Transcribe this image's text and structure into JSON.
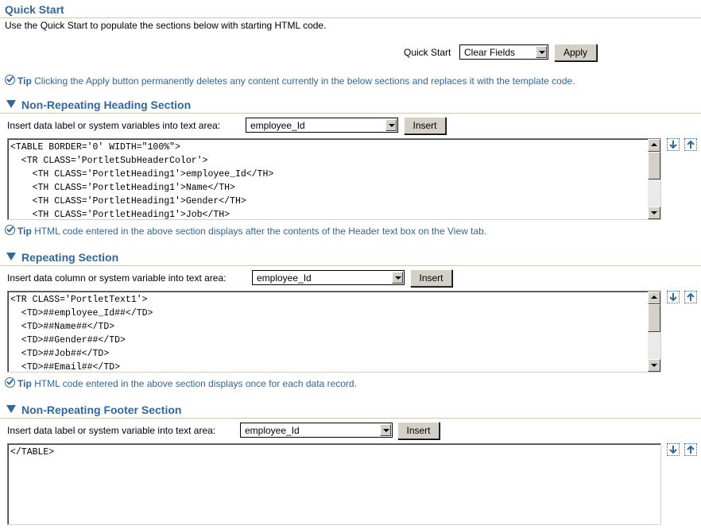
{
  "quick_start": {
    "title": "Quick Start",
    "description": "Use the Quick Start to populate the sections below with starting HTML code.",
    "label": "Quick Start",
    "selected": "Clear Fields",
    "apply_label": "Apply",
    "tip_label": "Tip",
    "tip_text": "Clicking the Apply button permanently deletes any content currently in the below sections and replaces it with the template code."
  },
  "heading_section": {
    "title": "Non-Repeating Heading Section",
    "insert_label": "Insert data label or system variables into text area:",
    "selected": "employee_Id",
    "insert_button": "Insert",
    "code": "<TABLE BORDER='0' WIDTH=\"100%\">\n  <TR CLASS='PortletSubHeaderColor'>\n    <TH CLASS='PortletHeading1'>employee_Id</TH>\n    <TH CLASS='PortletHeading1'>Name</TH>\n    <TH CLASS='PortletHeading1'>Gender</TH>\n    <TH CLASS='PortletHeading1'>Job</TH>",
    "tip_label": "Tip",
    "tip_text": "HTML code entered in the above section displays after the contents of the Header text box on the View tab."
  },
  "repeating_section": {
    "title": "Repeating Section",
    "insert_label": "Insert data column or system variable into text area:",
    "selected": "employee_Id",
    "insert_button": "Insert",
    "code": "<TR CLASS='PortletText1'>\n  <TD>##employee_Id##</TD>\n  <TD>##Name##</TD>\n  <TD>##Gender##</TD>\n  <TD>##Job##</TD>\n  <TD>##Email##</TD>",
    "tip_label": "Tip",
    "tip_text": "HTML code entered in the above section displays once for each data record."
  },
  "footer_section": {
    "title": "Non-Repeating Footer Section",
    "insert_label": "Insert data label or system variable into text area:",
    "selected": "employee_Id",
    "insert_button": "Insert",
    "code": "</TABLE>"
  },
  "colors": {
    "accent": "#336699",
    "rule": "#c9cbb7",
    "button_face": "#d4d0c8"
  }
}
